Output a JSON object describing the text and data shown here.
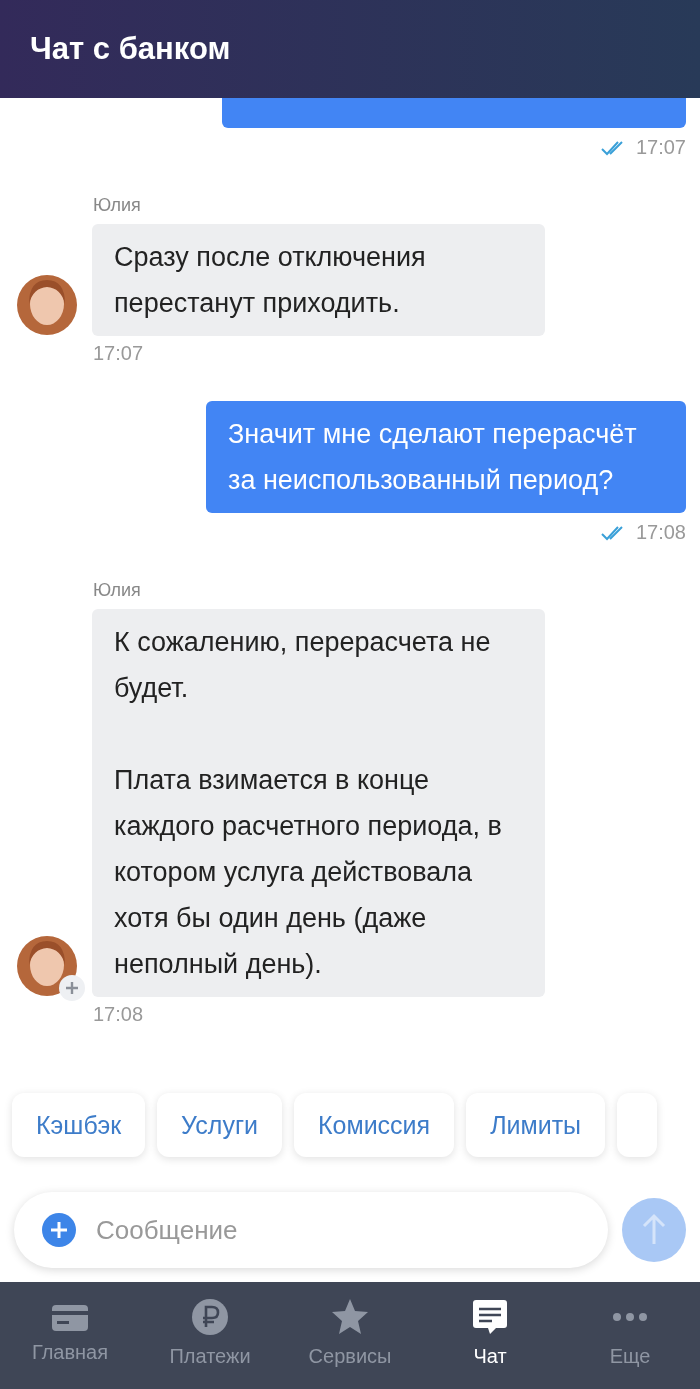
{
  "header": {
    "title": "Чат с банком"
  },
  "messages": [
    {
      "kind": "outgoing",
      "time": "17:07",
      "read": true
    },
    {
      "kind": "incoming",
      "sender": "Юлия",
      "paragraphs": [
        "Сразу после отключения перестанут приходить."
      ],
      "time": "17:07",
      "avatar_badge": false
    },
    {
      "kind": "outgoing",
      "paragraphs": [
        "Значит мне сделают перерасчёт за неиспользованный период?"
      ],
      "time": "17:08",
      "read": true
    },
    {
      "kind": "incoming",
      "sender": "Юлия",
      "paragraphs": [
        "К сожалению, перерасчета не будет.",
        "Плата взимается в конце каждого расчетного периода, в котором услуга действовала хотя бы один день (даже неполный день)."
      ],
      "time": "17:08",
      "avatar_badge": true
    }
  ],
  "quick_replies": [
    "Кэшбэк",
    "Услуги",
    "Комиссия",
    "Лимиты"
  ],
  "composer": {
    "placeholder": "Сообщение"
  },
  "nav": [
    {
      "kind": "card",
      "label": "Главная",
      "selected": false
    },
    {
      "kind": "ruble",
      "label": "Платежи",
      "selected": false
    },
    {
      "kind": "star",
      "label": "Сервисы",
      "selected": false
    },
    {
      "kind": "chat",
      "label": "Чат",
      "selected": true
    },
    {
      "kind": "more",
      "label": "Еще",
      "selected": false
    }
  ]
}
